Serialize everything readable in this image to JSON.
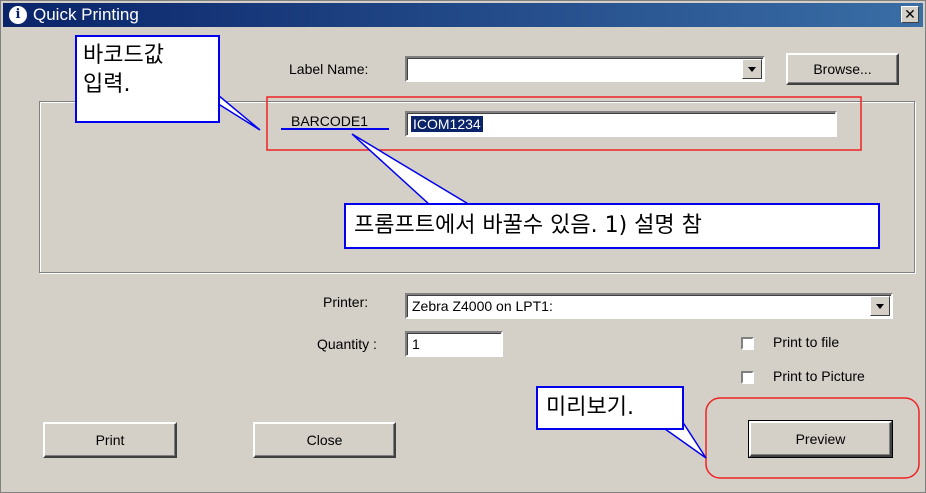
{
  "window": {
    "title": "Quick Printing",
    "close_glyph": "✕"
  },
  "label_name": {
    "label": "Label Name:",
    "value": "",
    "browse": "Browse..."
  },
  "barcode": {
    "label": "BARCODE1",
    "value": "ICOM1234"
  },
  "printer": {
    "label": "Printer:",
    "value": "Zebra Z4000 on LPT1:"
  },
  "quantity": {
    "label": "Quantity :",
    "value": "1"
  },
  "options": {
    "print_to_file": "Print to file",
    "print_to_picture": "Print to Picture"
  },
  "buttons": {
    "print": "Print",
    "close": "Close",
    "preview": "Preview"
  },
  "annotations": {
    "barcode_input": "바코드값\n입력.",
    "prompt_note": "프롬프트에서 바꿀수 있음. 1) 설명 참",
    "preview_note": "미리보기."
  },
  "colors": {
    "titlebar": "#0a246a",
    "annotation_outline": "#ee2222",
    "callout_border": "#0000ee"
  }
}
